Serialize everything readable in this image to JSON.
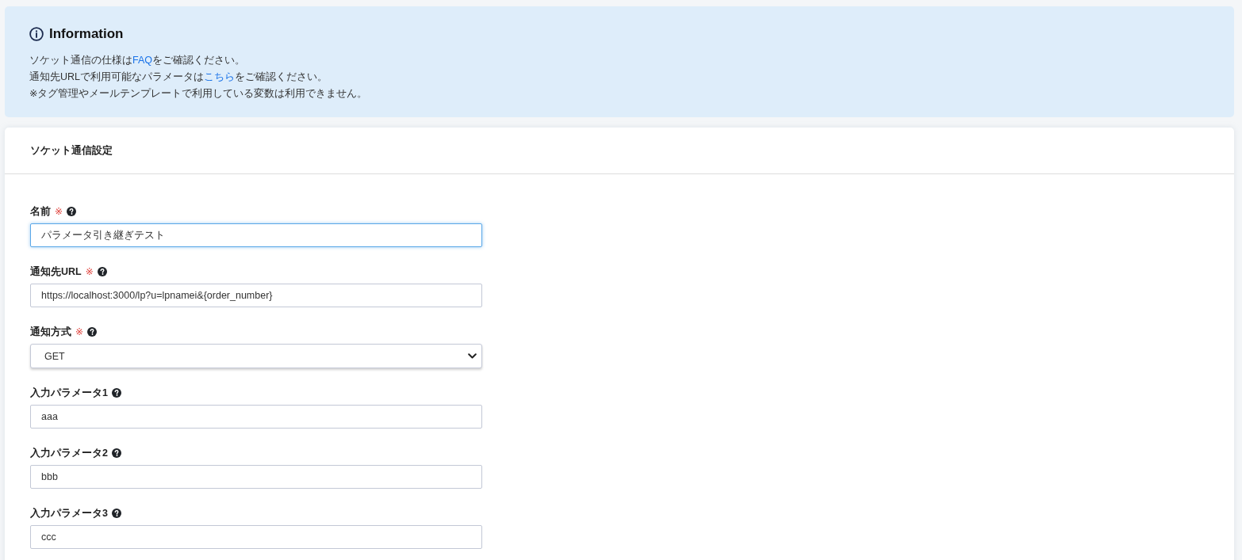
{
  "info": {
    "title": "Information",
    "lines": [
      [
        {
          "kind": "text",
          "text": "ソケット通信の仕様は"
        },
        {
          "kind": "link",
          "text": "FAQ"
        },
        {
          "kind": "text",
          "text": "をご確認ください。"
        }
      ],
      [
        {
          "kind": "text",
          "text": "通知先URLで利用可能なパラメータは"
        },
        {
          "kind": "link",
          "text": "こちら"
        },
        {
          "kind": "text",
          "text": "をご確認ください。"
        }
      ],
      [
        {
          "kind": "text",
          "text": "※タグ管理やメールテンプレートで利用している変数は利用できません。"
        }
      ]
    ]
  },
  "card": {
    "title": "ソケット通信設定",
    "fields": [
      {
        "kind": "text",
        "label": "名前",
        "required_mark": "※",
        "value": "パラメータ引き継ぎテスト",
        "focused": true
      },
      {
        "kind": "text",
        "label": "通知先URL",
        "required_mark": "※",
        "value": "https://localhost:3000/lp?u=lpnamei&{order_number}",
        "focused": false
      },
      {
        "kind": "select",
        "label": "通知方式",
        "required_mark": "※",
        "value": "GET",
        "focused": false
      },
      {
        "kind": "text",
        "label": "入力パラメータ1",
        "value": "aaa",
        "focused": false
      },
      {
        "kind": "text",
        "label": "入力パラメータ2",
        "value": "bbb",
        "focused": false
      },
      {
        "kind": "text",
        "label": "入力パラメータ3",
        "value": "ccc",
        "focused": false
      }
    ]
  }
}
